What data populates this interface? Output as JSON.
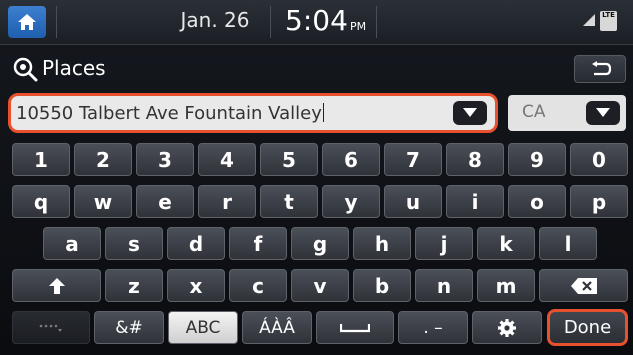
{
  "status_bar": {
    "date": "Jan. 26",
    "time": "5:04",
    "ampm": "PM",
    "lte_label": "LTE"
  },
  "header": {
    "title": "Places"
  },
  "search": {
    "address_value": "10550 Talbert Ave Fountain Valley",
    "state_value": "CA"
  },
  "keyboard": {
    "row_numbers": [
      "1",
      "2",
      "3",
      "4",
      "5",
      "6",
      "7",
      "8",
      "9",
      "0"
    ],
    "row_top": [
      "q",
      "w",
      "e",
      "r",
      "t",
      "y",
      "u",
      "i",
      "o",
      "p"
    ],
    "row_middle": [
      "a",
      "s",
      "d",
      "f",
      "g",
      "h",
      "j",
      "k",
      "l"
    ],
    "row_bottom": [
      "z",
      "x",
      "c",
      "v",
      "b",
      "n",
      "m"
    ],
    "symbols_label": "&#",
    "abc_label": "ABC",
    "accents_label": "ÁÀÂ",
    "punct_label": ". –",
    "done_label": "Done"
  },
  "colors": {
    "highlight": "#e8512e",
    "home_button": "#2f6fc0"
  },
  "icons": [
    "home-icon",
    "places-search-icon",
    "back-icon",
    "dropdown-arrow-icon",
    "shift-icon",
    "backspace-icon",
    "space-icon",
    "settings-icon",
    "signal-icon",
    "lte-icon"
  ]
}
